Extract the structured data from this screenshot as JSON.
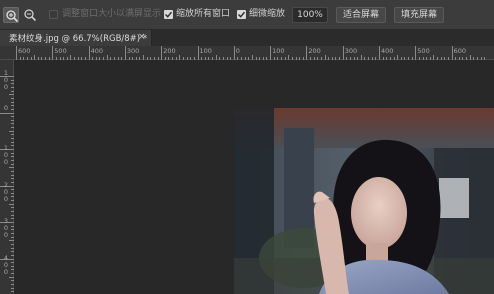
{
  "options_bar": {
    "zoom_in_tool": "zoom-in-icon",
    "zoom_out_tool": "zoom-out-icon",
    "resize_windows_label": "调整窗口大小以满屏显示",
    "zoom_all_windows_label": "缩放所有窗口",
    "scrubby_zoom_label": "细微缩放",
    "zoom_value": "100%",
    "fit_screen_label": "适合屏幕",
    "fill_screen_label": "填充屏幕",
    "resize_windows_checked": false,
    "zoom_all_windows_checked": true,
    "scrubby_zoom_checked": true
  },
  "document_tab": {
    "title": "素材纹身.jpg @ 66.7%(RGB/8#) *",
    "close": "×"
  },
  "ruler_top": {
    "labels": [
      "600",
      "500",
      "400",
      "300",
      "200",
      "100",
      "0",
      "100",
      "200",
      "300",
      "400",
      "500",
      "600"
    ]
  },
  "ruler_left": {
    "labels": [
      "1\n0\n0",
      "0",
      "1\n0\n0",
      "2\n0\n0",
      "3\n0\n0",
      "4\n0\n0"
    ]
  },
  "colors": {
    "options_bg": "#3c3c3c",
    "canvas_bg": "#282828",
    "ruler_bg": "#353535"
  }
}
